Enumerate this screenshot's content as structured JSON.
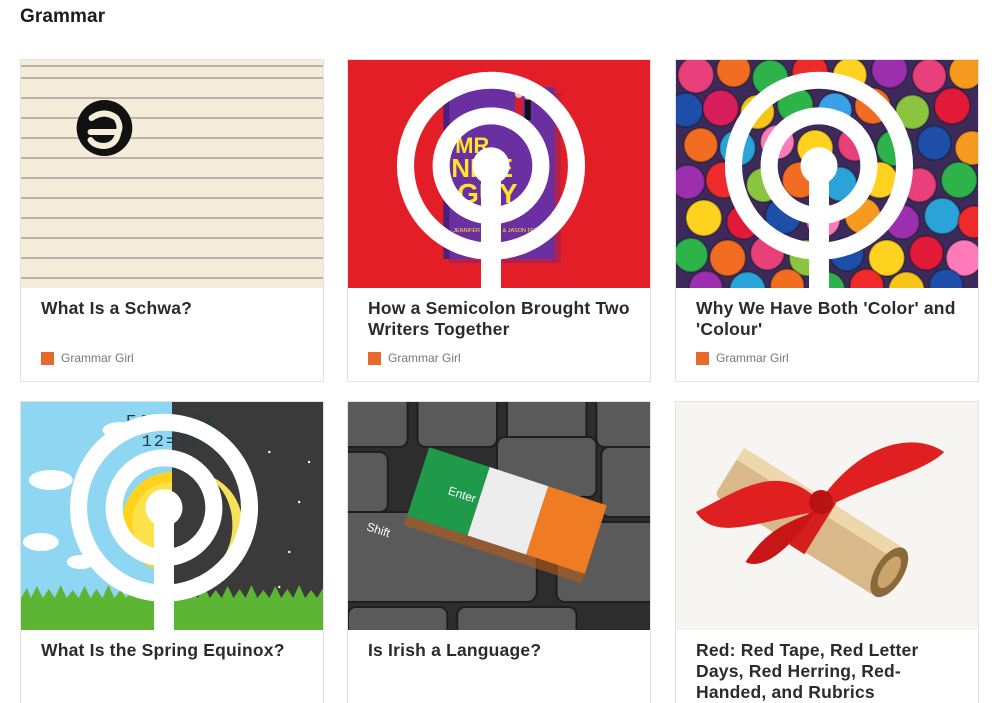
{
  "section": {
    "title": "Grammar"
  },
  "cards": [
    {
      "title": "What Is a Schwa?",
      "source": "Grammar Girl",
      "image": "schwa-on-lined-paper"
    },
    {
      "title": "How a Semicolon Brought Two Writers Together",
      "source": "Grammar Girl",
      "image": "book-cover-mr-nice-guy",
      "book": {
        "title_line1": "MR.",
        "title_line2": "NICE",
        "title_line3": "GUY",
        "authors": "JENNIFER MILLER & JASON FEIFER"
      }
    },
    {
      "title": "Why We Have Both 'Color' and 'Colour'",
      "source": "Grammar Girl",
      "image": "colorful-fabric-rolls"
    },
    {
      "title": "What Is the Spring Equinox?",
      "source": "",
      "image": "equinox-sun-moon",
      "art": {
        "line1": "EQUINOX",
        "line2": "12=12"
      }
    },
    {
      "title": "Is Irish a Language?",
      "source": "",
      "image": "keyboard-irish-flag-key",
      "art": {
        "enter": "Enter",
        "shift": "Shift"
      }
    },
    {
      "title": "Red: Red Tape, Red Letter Days, Red Herring, Red-Handed, and Rubrics",
      "source": "",
      "image": "scroll-with-red-ribbon"
    }
  ],
  "colors": {
    "source_swatch": "#e8692d",
    "card_border": "#e2e2e2",
    "cover_background": "#e41e26",
    "book_cover": "#6a2fa0"
  }
}
